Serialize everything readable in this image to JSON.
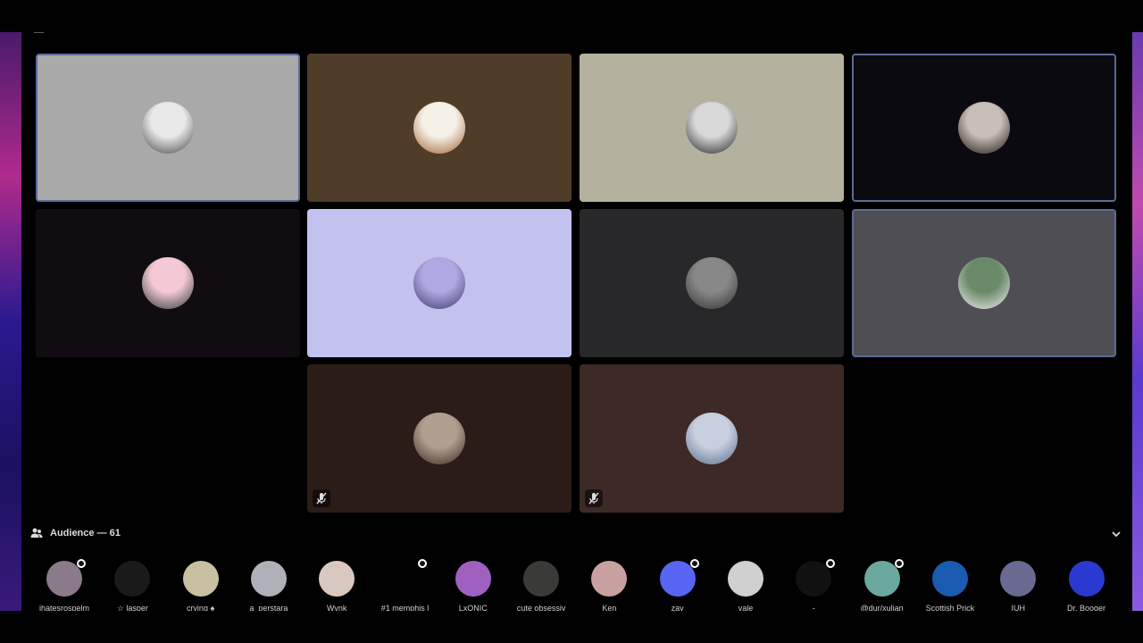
{
  "stage": {
    "top_label": "—",
    "tiles": [
      {
        "bg": "#a9a9a9",
        "selected": true,
        "muted": false,
        "avatar": [
          "#e8e8e8",
          "#444"
        ]
      },
      {
        "bg": "#4f3d2a",
        "selected": false,
        "muted": false,
        "avatar": [
          "#f5f0e8",
          "#a06030"
        ]
      },
      {
        "bg": "#b4b29e",
        "selected": false,
        "muted": false,
        "avatar": [
          "#d8d8d8",
          "#222"
        ]
      },
      {
        "bg": "#0b0a10",
        "selected": true,
        "muted": false,
        "avatar": [
          "#c8c0b8",
          "#1a1510"
        ]
      },
      {
        "bg": "#100c12",
        "selected": false,
        "muted": false,
        "avatar": [
          "#f4c8d4",
          "#2a3a3a"
        ]
      },
      {
        "bg": "#c3c2ee",
        "selected": false,
        "muted": false,
        "avatar": [
          "#b0a8e0",
          "#3a3a6a"
        ]
      },
      {
        "bg": "#28282a",
        "selected": false,
        "muted": false,
        "avatar": [
          "#888",
          "#333"
        ]
      },
      {
        "bg": "#4e4e54",
        "selected": true,
        "muted": false,
        "avatar": [
          "#6a8a6a",
          "#f0f0f0"
        ]
      },
      {
        "bg": "#2c1c18",
        "selected": false,
        "muted": true,
        "avatar": [
          "#b0a090",
          "#3a2a20"
        ]
      },
      {
        "bg": "#3d2a26",
        "selected": false,
        "muted": true,
        "avatar": [
          "#c8d0e0",
          "#5a6a8a"
        ]
      }
    ]
  },
  "audience": {
    "title": "Audience — 61",
    "members": [
      {
        "name": "ihatesrospelm",
        "color": "#8a7a8a",
        "dot": true
      },
      {
        "name": "☆ lasper",
        "color": "#1a1a1a",
        "dot": false
      },
      {
        "name": "crying ♠",
        "color": "#c8c0a0",
        "dot": false
      },
      {
        "name": "a_perstara",
        "color": "#b0b0b8",
        "dot": false
      },
      {
        "name": "Wynk",
        "color": "#d8c8c0",
        "dot": false
      },
      {
        "name": "#1 memphis l",
        "color": "#000000",
        "dot": true
      },
      {
        "name": "LxONIC",
        "color": "#a060c0",
        "dot": false
      },
      {
        "name": "cute obsessiv",
        "color": "#3a3a38",
        "dot": false
      },
      {
        "name": "Ken",
        "color": "#c8a0a0",
        "dot": false
      },
      {
        "name": "zay",
        "color": "#5865f2",
        "dot": true
      },
      {
        "name": "vale",
        "color": "#d0d0d0",
        "dot": false
      },
      {
        "name": "-",
        "color": "#111111",
        "dot": true
      },
      {
        "name": "@dur/xulian",
        "color": "#6aa8a0",
        "dot": true
      },
      {
        "name": "Scottish Prick",
        "color": "#1a5ab0",
        "dot": false
      },
      {
        "name": "IUH",
        "color": "#6a6a90",
        "dot": false
      },
      {
        "name": "Dr. Booger",
        "color": "#2a3ad0",
        "dot": false
      }
    ]
  }
}
